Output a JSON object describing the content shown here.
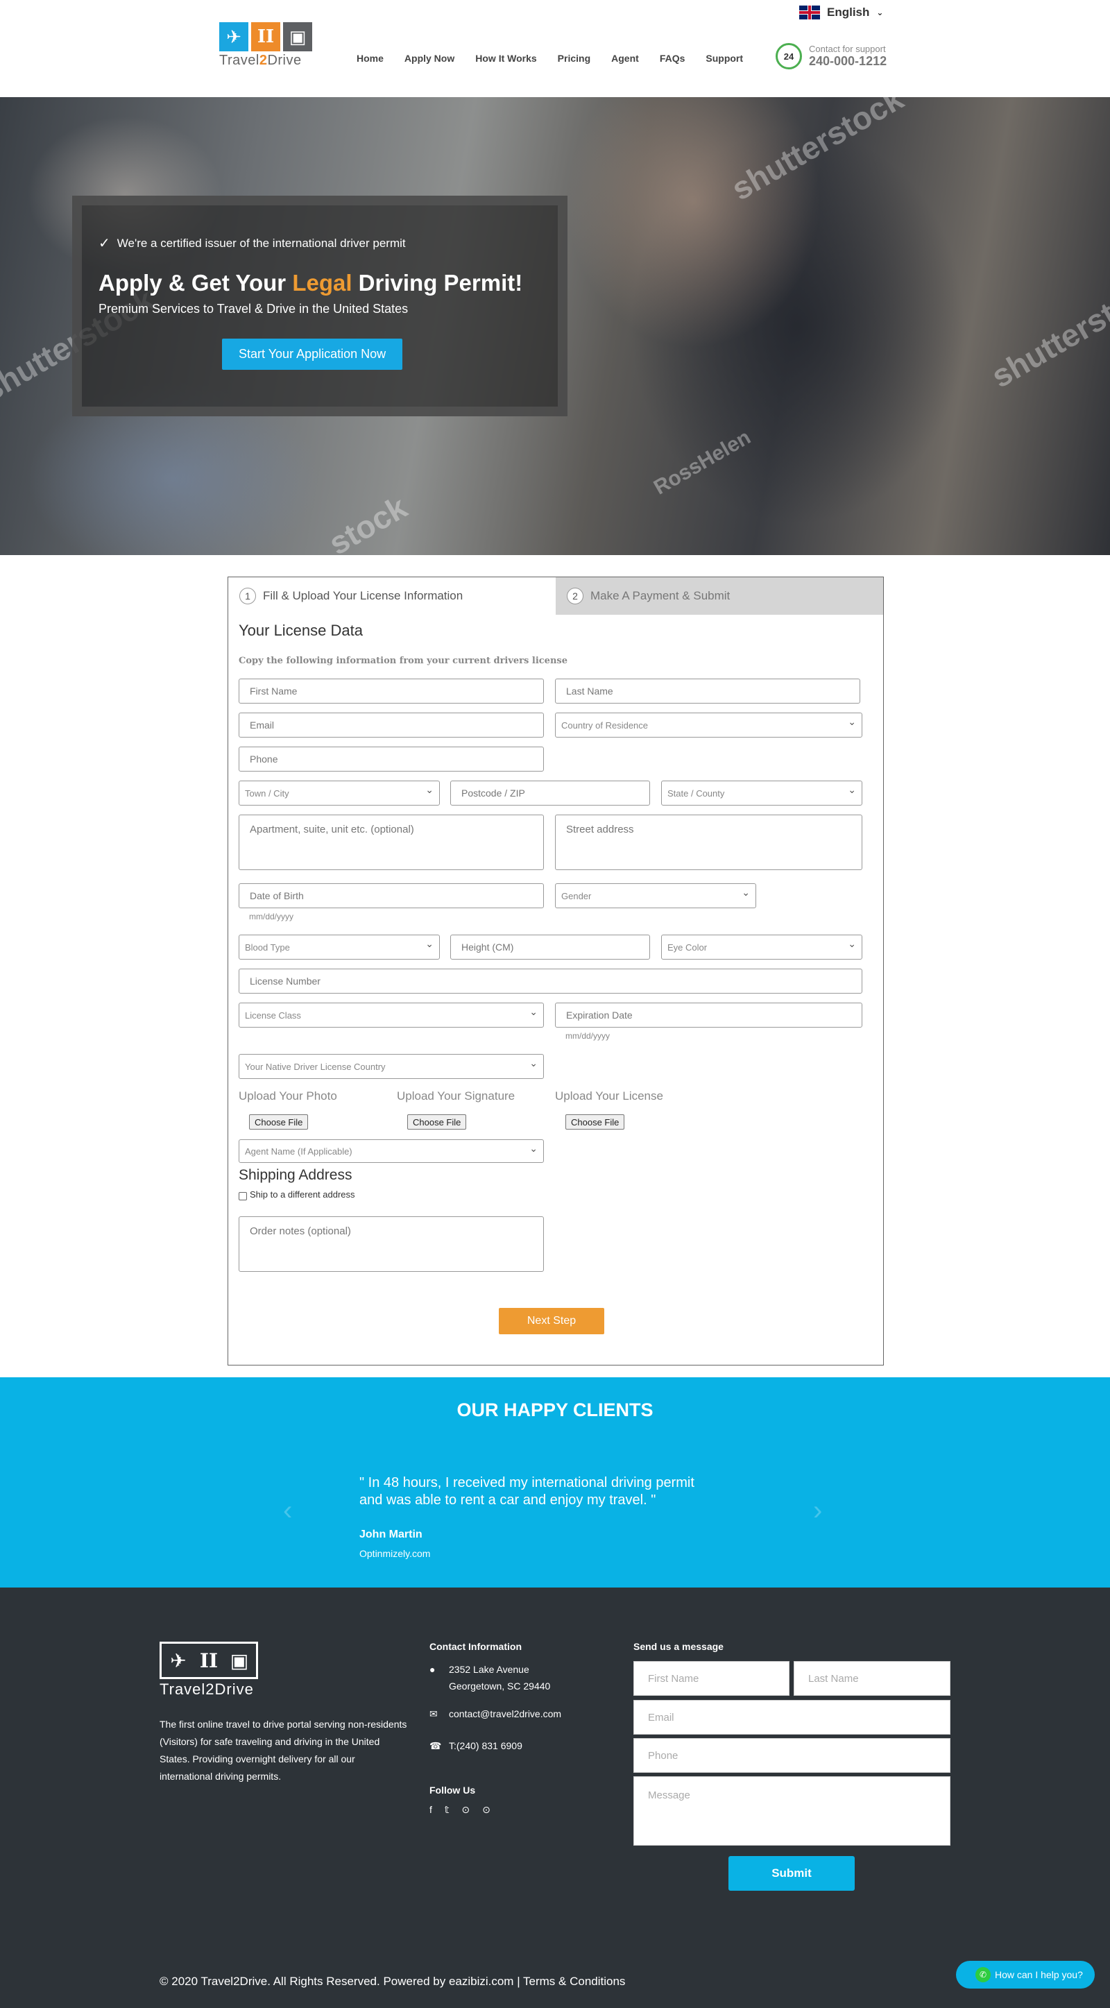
{
  "header": {
    "language": "English",
    "logo_text_a": "Travel",
    "logo_text_b": "2",
    "logo_text_c": "Drive",
    "nav": [
      "Home",
      "Apply Now",
      "How It Works",
      "Pricing",
      "Agent",
      "FAQs",
      "Support"
    ],
    "support_badge": "24",
    "support_label": "Contact for support",
    "support_phone": "240-000-1212"
  },
  "hero": {
    "certified": "We're a certified issuer of the international driver permit",
    "title_a": "Apply & Get Your ",
    "title_accent": "Legal",
    "title_b": " Driving Permit!",
    "subtitle": "Premium Services to Travel & Drive in the United States",
    "cta": "Start Your Application Now",
    "watermarks": [
      "shutterstock",
      "shutterstock",
      "shutterst",
      "RossHelen",
      "stock"
    ]
  },
  "form": {
    "step1_num": "1",
    "step1_label": "Fill & Upload Your License Information",
    "step2_num": "2",
    "step2_label": "Make A Payment & Submit",
    "title": "Your License Data",
    "hint": "Copy the following information from your current drivers license",
    "first_name": "First Name",
    "last_name": "Last Name",
    "email": "Email",
    "country": "Country of Residence",
    "phone": "Phone",
    "town": "Town / City",
    "postcode": "Postcode / ZIP",
    "state": "State / County",
    "apartment": "Apartment, suite, unit etc. (optional)",
    "street": "Street address",
    "dob": "Date of Birth",
    "dob_hint": "mm/dd/yyyy",
    "gender": "Gender",
    "blood": "Blood Type",
    "height": "Height (CM)",
    "eye": "Eye Color",
    "license_number": "License Number",
    "license_class": "License Class",
    "expiration": "Expiration Date",
    "exp_hint": "mm/dd/yyyy",
    "native_country": "Your Native Driver License Country",
    "upload_photo": "Upload Your Photo",
    "upload_signature": "Upload Your Signature",
    "upload_license": "Upload Your License",
    "choose_file": "Choose File",
    "agent": "Agent Name (If Applicable)",
    "shipping_title": "Shipping Address",
    "ship_different": "Ship to a different address",
    "order_notes": "Order notes (optional)",
    "next": "Next Step"
  },
  "clients": {
    "title": "OUR HAPPY CLIENTS",
    "quote": "\" In 48 hours, I received my international driving permit and was able to rent a car and enjoy my travel. \"",
    "name": "John Martin",
    "site": "Optinmizely.com",
    "prev": "‹",
    "next": "›"
  },
  "footer": {
    "logo_text": "Travel2Drive",
    "about": "The first online travel to drive portal serving non-residents (Visitors) for safe traveling and driving in the United States. Providing overnight delivery for all our international driving permits.",
    "contact_title": "Contact Information",
    "address_1": "2352 Lake Avenue",
    "address_2": "Georgetown, SC 29440",
    "email": "contact@travel2drive.com",
    "phone": "T:(240) 831 6909",
    "follow_title": "Follow Us",
    "social": [
      "f",
      "𝕥",
      "⊙",
      "⊙"
    ],
    "message_title": "Send us a message",
    "first_name": "First Name",
    "last_name": "Last Name",
    "email_ph": "Email",
    "phone_ph": "Phone",
    "message_ph": "Message",
    "submit": "Submit",
    "copyright": "© 2020 Travel2Drive. All Rights Reserved. Powered by eazibizi.com | Terms & Conditions",
    "whatsapp": "How can I help you?"
  },
  "colors": {
    "accent_blue": "#09b2e5",
    "accent_orange": "#ee9b32",
    "footer_bg": "#2d3338"
  }
}
